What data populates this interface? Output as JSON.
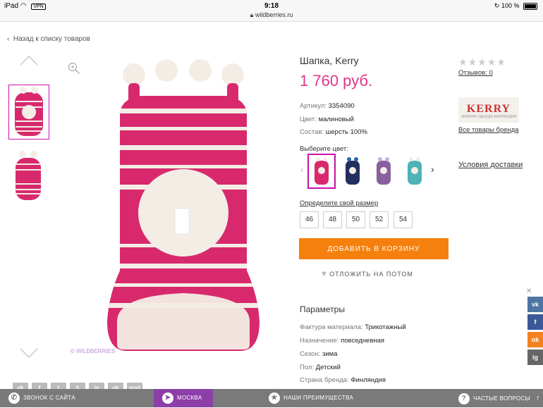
{
  "status_bar": {
    "device": "iPad",
    "vpn": "VPN",
    "time": "9:18",
    "url": "wildberries.ru",
    "battery": "100 %"
  },
  "nav": {
    "back_label": "Назад к списку товаров"
  },
  "gallery": {
    "watermark": "© WILDBERRIES"
  },
  "product": {
    "title": "Шапка, Kerry",
    "price": "1 760 руб.",
    "specs": [
      {
        "label": "Артикул:",
        "value": "3354090"
      },
      {
        "label": "Цвет:",
        "value": "малиновый"
      },
      {
        "label": "Состав:",
        "value": "шерсть 100%"
      }
    ],
    "choose_color_label": "Выберите цвет:",
    "colors": [
      "#d8296d",
      "#23305e",
      "#8a5f9e",
      "#4fb3b6"
    ],
    "size_title": "Определите свой размер",
    "sizes": [
      "46",
      "48",
      "50",
      "52",
      "54"
    ],
    "add_to_cart": "ДОБАВИТЬ В КОРЗИНУ",
    "postpone": "ОТЛОЖИТЬ НА ПОТОМ",
    "params_title": "Параметры",
    "params": [
      {
        "label": "Фактура материала:",
        "value": "Трикотажный"
      },
      {
        "label": "Назначение:",
        "value": "повседневная"
      },
      {
        "label": "Сезон:",
        "value": "зима"
      },
      {
        "label": "Пол:",
        "value": "Детский"
      },
      {
        "label": "Страна бренда:",
        "value": "Финляндия"
      }
    ]
  },
  "sidebar": {
    "rating_stars": 0,
    "reviews": "Отзывов: 0",
    "brand_logo": "KERRY",
    "brand_tagline": "ЗИМНЯЯ ОДЕЖДА ФИНЛЯНДИЯ",
    "brand_link": "Все товары бренда",
    "delivery": "Условия доставки"
  },
  "share": {
    "buttons": [
      "vk",
      "f",
      "t",
      "lj",
      "ig",
      "ok",
      "mail"
    ]
  },
  "side_social": {
    "close": "✕",
    "buttons": [
      {
        "label": "vk",
        "color": "#4c75a3"
      },
      {
        "label": "f",
        "color": "#3b5998"
      },
      {
        "label": "ok",
        "color": "#f58220"
      },
      {
        "label": "ig",
        "color": "#666666"
      }
    ]
  },
  "bottom_bar": {
    "call": "ЗВОНОК С САЙТА",
    "city": "МОСКВА",
    "advantages": "НАШИ ПРЕИМУЩЕСТВА",
    "faq": "ЧАСТЫЕ ВОПРОСЫ"
  },
  "theme": {
    "accent": "#cb11ab",
    "price": "#e4348b",
    "cta": "#f6800e",
    "hat_pink": "#d8296d",
    "hat_white": "#f3ede6"
  }
}
